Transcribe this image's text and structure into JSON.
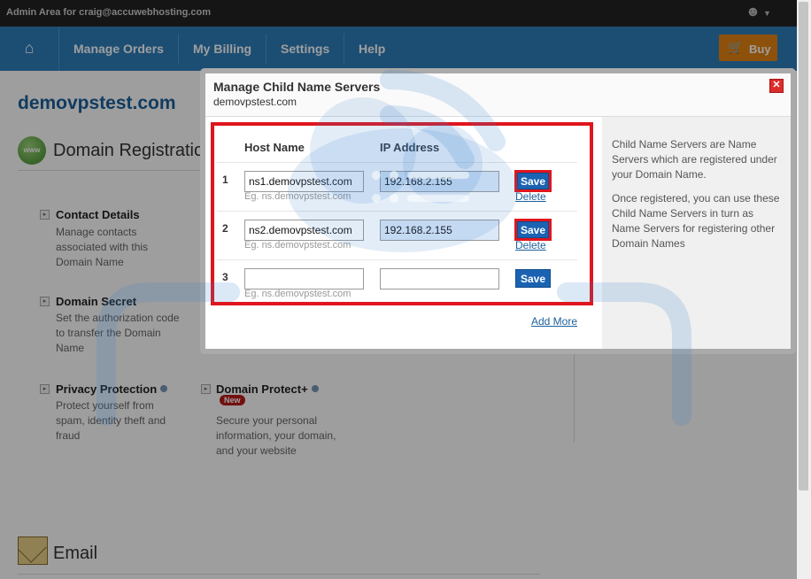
{
  "topbar": {
    "admin_text": "Admin Area for craig@accuwebhosting.com"
  },
  "nav": {
    "items": [
      "Manage Orders",
      "My Billing",
      "Settings",
      "Help"
    ],
    "buy_label": "Buy"
  },
  "page": {
    "domain": "demovpstest.com",
    "section_title": "Domain Registration",
    "contact": {
      "title": "Contact Details",
      "desc": "Manage contacts associated with this Domain Name"
    },
    "secret": {
      "title": "Domain Secret",
      "desc": "Set the authorization code to transfer the Domain Name"
    },
    "privacy": {
      "title": "Privacy Protection",
      "desc": "Protect yourself from spam, identity theft and fraud"
    },
    "protect": {
      "title": "Domain Protect+",
      "badge": "New",
      "desc": "Secure your personal information, your domain, and your website"
    },
    "email_title": "Email"
  },
  "dialog": {
    "title": "Manage Child Name Servers",
    "subtitle": "demovpstest.com",
    "close_label": "✕",
    "col_host": "Host Name",
    "col_ip": "IP Address",
    "rows": [
      {
        "num": "1",
        "host": "ns1.demovpstest.com",
        "ip": "192.168.2.155",
        "hint": "Eg. ns.demovpstest.com",
        "save": "Save",
        "delete": "Delete"
      },
      {
        "num": "2",
        "host": "ns2.demovpstest.com",
        "ip": "192.168.2.155",
        "hint": "Eg. ns.demovpstest.com",
        "save": "Save",
        "delete": "Delete"
      },
      {
        "num": "3",
        "host": "",
        "ip": "",
        "hint": "Eg. ns.demovpstest.com",
        "save": "Save"
      }
    ],
    "add_more": "Add More",
    "info_p1": "Child Name Servers are Name Servers which are registered under your Domain Name.",
    "info_p2": "Once registered, you can use these Child Name Servers in turn as Name Servers for registering other Domain Names"
  },
  "colors": {
    "nav": "#2e7fbb",
    "buy": "#e48412",
    "save": "#1b63b2",
    "highlight": "#e0151e"
  }
}
